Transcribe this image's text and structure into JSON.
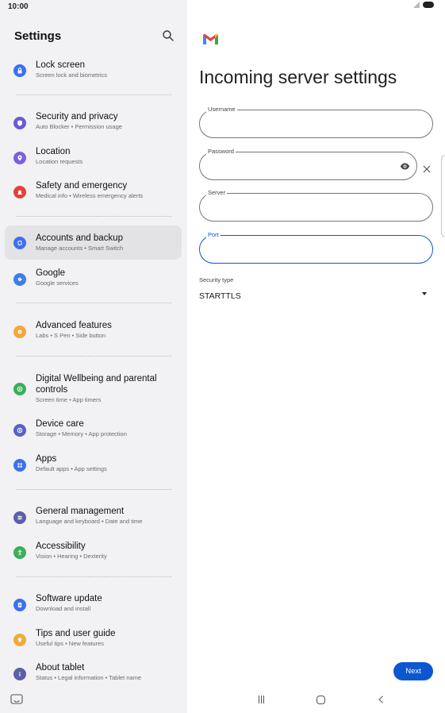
{
  "status": {
    "time": "10:00"
  },
  "left": {
    "title": "Settings",
    "items": [
      {
        "title": "Lock screen",
        "sub": "Screen lock and biometrics",
        "color": "#3c6ff5",
        "icon": "lock-icon"
      },
      {
        "title": "Security and privacy",
        "sub": "Auto Blocker • Permission usage",
        "color": "#6a5ad6",
        "icon": "shield-icon"
      },
      {
        "title": "Location",
        "sub": "Location requests",
        "color": "#7b5fe0",
        "icon": "location-pin-icon"
      },
      {
        "title": "Safety and emergency",
        "sub": "Medical info • Wireless emergency alerts",
        "color": "#e0433c",
        "icon": "alarm-bell-icon"
      },
      {
        "title": "Accounts and backup",
        "sub": "Manage accounts • Smart Switch",
        "color": "#3d6ff0",
        "icon": "sync-icon"
      },
      {
        "title": "Google",
        "sub": "Google services",
        "color": "#3f7de8",
        "icon": "google-icon"
      },
      {
        "title": "Advanced features",
        "sub": "Labs • S Pen • Side button",
        "color": "#f2a93b",
        "icon": "gear-icon"
      },
      {
        "title": "Digital Wellbeing and parental controls",
        "sub": "Screen time • App timers",
        "color": "#3cae5a",
        "icon": "wellbeing-icon"
      },
      {
        "title": "Device care",
        "sub": "Storage • Memory • App protection",
        "color": "#5861c8",
        "icon": "device-care-icon"
      },
      {
        "title": "Apps",
        "sub": "Default apps • App settings",
        "color": "#3d6ff0",
        "icon": "apps-grid-icon"
      },
      {
        "title": "General management",
        "sub": "Language and keyboard • Date and time",
        "color": "#5b5fa8",
        "icon": "sliders-icon"
      },
      {
        "title": "Accessibility",
        "sub": "Vision • Hearing • Dexterity",
        "color": "#3cae5a",
        "icon": "accessibility-icon"
      },
      {
        "title": "Software update",
        "sub": "Download and install",
        "color": "#3d6ff0",
        "icon": "update-icon"
      },
      {
        "title": "Tips and user guide",
        "sub": "Useful tips • New features",
        "color": "#f2a93b",
        "icon": "lightbulb-icon"
      },
      {
        "title": "About tablet",
        "sub": "Status • Legal information • Tablet name",
        "color": "#5b5fa8",
        "icon": "info-icon"
      }
    ]
  },
  "right": {
    "title": "Incoming server settings",
    "fields": {
      "username": {
        "label": "Username",
        "value": ""
      },
      "password": {
        "label": "Password",
        "value": ""
      },
      "server": {
        "label": "Server",
        "value": ""
      },
      "port": {
        "label": "Port",
        "value": ""
      }
    },
    "security": {
      "label": "Security type",
      "value": "STARTTLS"
    },
    "next_label": "Next"
  },
  "colors": {
    "accent": "#0b57d0",
    "panel_bg": "#f2f2f4",
    "selected_bg": "#e3e3e5"
  }
}
